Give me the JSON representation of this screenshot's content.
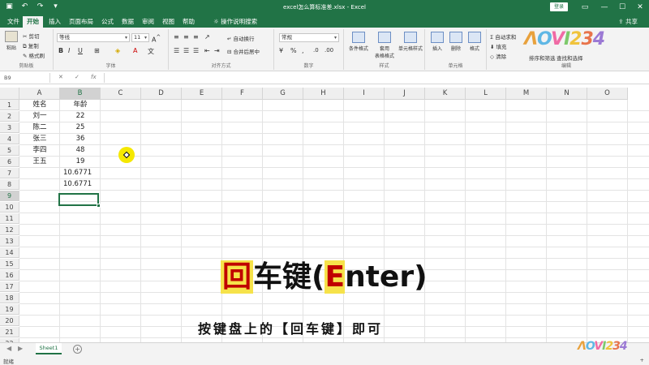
{
  "window": {
    "title": "excel怎么算标准差.xlsx  -  Excel",
    "login_label": "登录"
  },
  "tabs": [
    "文件",
    "开始",
    "插入",
    "页面布局",
    "公式",
    "数据",
    "审阅",
    "视图",
    "帮助"
  ],
  "tell_me": "操作说明搜索",
  "share_label": "共享",
  "ribbon": {
    "clipboard": {
      "paste": "粘贴",
      "cut": "剪切",
      "copy": "复制",
      "format_painter": "格式刷",
      "label": "剪贴板"
    },
    "font": {
      "name": "等线",
      "size": "11",
      "label": "字体"
    },
    "alignment": {
      "wrap": "自动换行",
      "merge": "合并后居中",
      "label": "对齐方式"
    },
    "number": {
      "format": "常规",
      "label": "数字"
    },
    "styles": {
      "conditional": "条件格式",
      "table": "套用\n表格格式",
      "cell": "单元格样式",
      "label": "样式"
    },
    "cells": {
      "insert": "插入",
      "delete": "删除",
      "format": "格式",
      "label": "单元格"
    },
    "editing": {
      "autosum": "自动求和",
      "fill": "填充",
      "clear": "清除",
      "sort": "排序和筛选",
      "find": "查找和选择",
      "label": "编辑"
    }
  },
  "formula_bar": {
    "name_box": "B9",
    "fx": "fx"
  },
  "columns": [
    "A",
    "B",
    "C",
    "D",
    "E",
    "F",
    "G",
    "H",
    "I",
    "J",
    "K",
    "L",
    "M",
    "N",
    "O"
  ],
  "rows": [
    "1",
    "2",
    "3",
    "4",
    "5",
    "6",
    "7",
    "8",
    "9",
    "10",
    "11",
    "12",
    "13",
    "14",
    "15",
    "16",
    "17",
    "18",
    "19",
    "20",
    "21",
    "22"
  ],
  "cells": {
    "A1": "姓名",
    "B1": "年龄",
    "A2": "刘一",
    "B2": "22",
    "A3": "陈二",
    "B3": "25",
    "A4": "张三",
    "B4": "36",
    "A5": "李四",
    "B5": "48",
    "A6": "王五",
    "B6": "19",
    "B7": "10.6771",
    "B8": "10.6771"
  },
  "selected_cell": "B9",
  "caption": {
    "main_red": "回",
    "main_black": "车键(",
    "main_E": "E",
    "main_rest": "nter)",
    "sub": "按键盘上的【回车键】即可"
  },
  "sheet_tab": "Sheet1",
  "status": "就绪",
  "zoom": "+",
  "watermark": "ΛOVI234",
  "colors": {
    "excel_green": "#217346",
    "caption_red": "#c00000",
    "highlight_yellow": "#f6e24a"
  }
}
